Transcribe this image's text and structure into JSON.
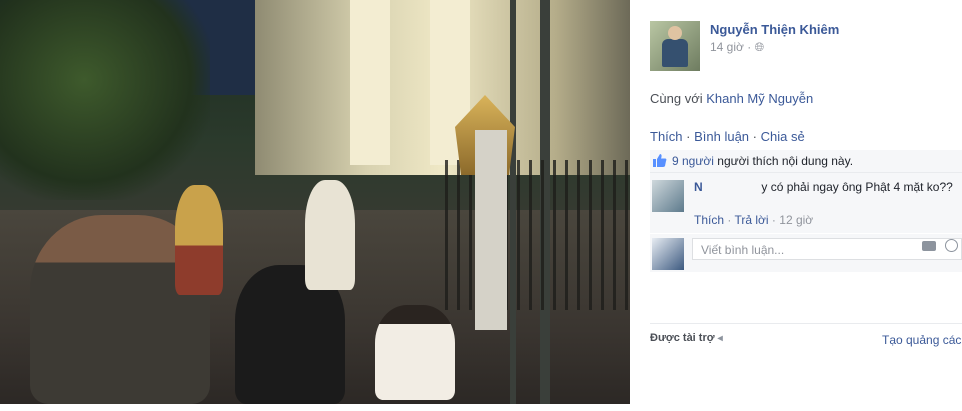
{
  "post": {
    "author": "Nguyễn Thiện Khiêm",
    "time": "14 giờ",
    "audience_icon": "globe-icon",
    "with_prefix": "Cùng với",
    "with_name": "Khanh Mỹ Nguyễn",
    "actions": [
      "Thích",
      "Bình luận",
      "Chia sẻ"
    ]
  },
  "likes": {
    "count_link": "9 người",
    "suffix": "người thích nội dung này."
  },
  "comment": {
    "name": "N",
    "text": "y có phải ngay ông Phật 4 mặt ko??",
    "like": "Thích",
    "reply": "Trả lời",
    "time": "12 giờ"
  },
  "compose": {
    "placeholder": "Viết bình luận..."
  },
  "sidebar": {
    "sponsored": "Được tài trợ",
    "create_ad": "Tạo quảng các"
  },
  "colors": {
    "link": "#3b5998",
    "muted": "#90949c"
  }
}
